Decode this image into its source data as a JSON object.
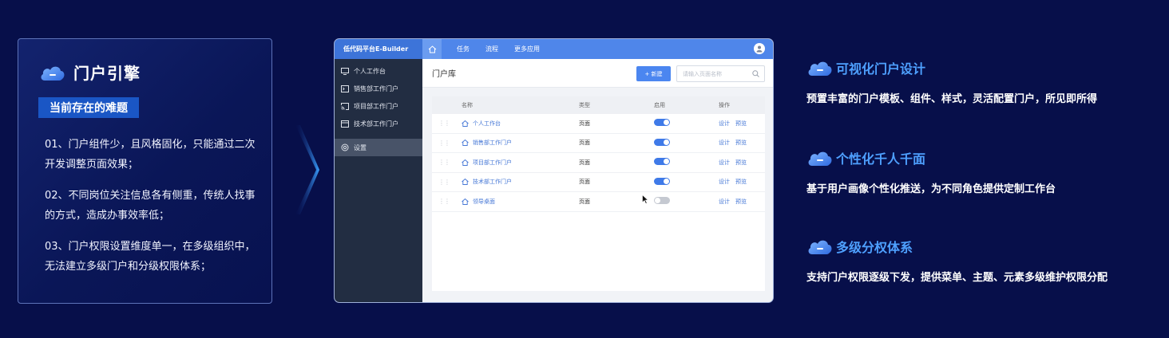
{
  "left_panel": {
    "title": "门户引擎",
    "tag": "当前存在的难题",
    "problems": [
      "01、门户组件少，且风格固化，只能通过二次开发调整页面效果；",
      "02、不同岗位关注信息各有侧重，传统人找事的方式，造成办事效率低；",
      "03、门户权限设置维度单一，在多级组织中，无法建立多级门户和分级权限体系；"
    ]
  },
  "app": {
    "brand": "低代码平台E-Builder",
    "nav": [
      "任务",
      "流程",
      "更多应用"
    ],
    "sidebar": [
      "个人工作台",
      "销售部工作门户",
      "项目部工作门户",
      "技术部工作门户",
      "设置"
    ],
    "page_title": "门户库",
    "new_button": "+ 新建",
    "search_placeholder": "请输入页面名称",
    "columns": [
      "名称",
      "类型",
      "启用",
      "操作"
    ],
    "rows": [
      {
        "name": "个人工作台",
        "type": "页面",
        "enabled": true
      },
      {
        "name": "销售部工作门户",
        "type": "页面",
        "enabled": true
      },
      {
        "name": "项目部工作门户",
        "type": "页面",
        "enabled": true
      },
      {
        "name": "技术部工作门户",
        "type": "页面",
        "enabled": true
      },
      {
        "name": "领导桌面",
        "type": "页面",
        "enabled": false
      }
    ],
    "actions": [
      "设计",
      "预览"
    ]
  },
  "features": [
    {
      "title": "可视化门户设计",
      "desc": "预置丰富的门户模板、组件、样式，灵活配置门户，所见即所得"
    },
    {
      "title": "个性化千人千面",
      "desc": "基于用户画像个性化推送，为不同角色提供定制工作台"
    },
    {
      "title": "多级分权体系",
      "desc": "支持门户权限逐级下发，提供菜单、主题、元素多级维护权限分配"
    }
  ],
  "colors": {
    "background": "#070f4a",
    "accent": "#4ea0ff",
    "tag": "#1a56c5",
    "topbar": "#4f86ea",
    "sidebar": "#222d42"
  }
}
